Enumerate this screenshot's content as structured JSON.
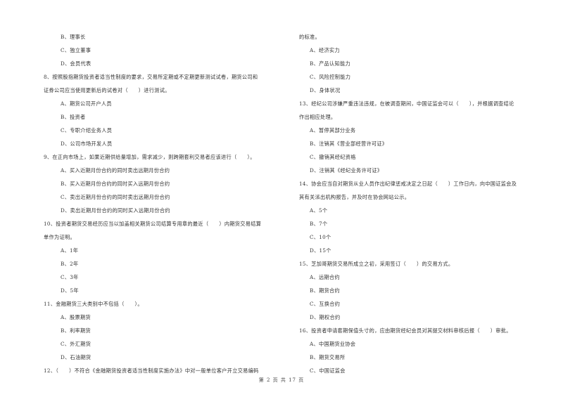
{
  "left_column": [
    {
      "type": "opt",
      "text": "B、理事长"
    },
    {
      "type": "opt",
      "text": "C、独立董事"
    },
    {
      "type": "opt",
      "text": "D、会员代表"
    },
    {
      "type": "q",
      "text": "8、按照股指期货投资者适当性制度的要求，交易所定期或不定期更新测试试卷，期货公司和"
    },
    {
      "type": "q",
      "text": "证券公司应当使用更新后的试卷对（　　）进行测试。"
    },
    {
      "type": "opt",
      "text": "A、期货公司开户人员"
    },
    {
      "type": "opt",
      "text": "B、投资者"
    },
    {
      "type": "opt",
      "text": "C、专职介绍业务人员"
    },
    {
      "type": "opt",
      "text": "D、公司市场开发人员"
    },
    {
      "type": "q",
      "text": "9、在正向市场上，如果近期供给量增加，需求减少，则跨期套利交易者应该进行（　　）。"
    },
    {
      "type": "opt",
      "text": "A、买入近期月份合约的同时卖出远期月份合约"
    },
    {
      "type": "opt",
      "text": "B、买入近期月份合约的同时买入远期月份合约"
    },
    {
      "type": "opt",
      "text": "C、卖出近期月份合约的同时卖出远期月份合约"
    },
    {
      "type": "opt",
      "text": "D、卖出近期月份合约的同时买入远期月份合约"
    },
    {
      "type": "q",
      "text": "10、投资者期货交易经历应当以加盖相关期货公司结算专用章的最近（　　）内期货交易结算"
    },
    {
      "type": "q",
      "text": "单作为证明。"
    },
    {
      "type": "opt",
      "text": "A、1年"
    },
    {
      "type": "opt",
      "text": "B、2年"
    },
    {
      "type": "opt",
      "text": "C、3年"
    },
    {
      "type": "opt",
      "text": "D、5年"
    },
    {
      "type": "q",
      "text": "11、金融期货三大类别中不包括（　　）。"
    },
    {
      "type": "opt",
      "text": "A、股票期货"
    },
    {
      "type": "opt",
      "text": "B、利率期货"
    },
    {
      "type": "opt",
      "text": "C、外汇期货"
    },
    {
      "type": "opt",
      "text": "D、石油期货"
    },
    {
      "type": "q",
      "text": "12、（　　）不符合《金融期货投资者适当性制度实施办法》中对一般单位客户开立交易编码"
    }
  ],
  "right_column": [
    {
      "type": "q",
      "text": "的标准。"
    },
    {
      "type": "opt",
      "text": "A、经济实力"
    },
    {
      "type": "opt",
      "text": "B、产品认知能力"
    },
    {
      "type": "opt",
      "text": "C、风险控制能力"
    },
    {
      "type": "opt",
      "text": "D、身体状况"
    },
    {
      "type": "q",
      "text": "13、经纪公司涉嫌严重违法违规，在被调查期间，中国证监会可以（　　），并根据调查结论"
    },
    {
      "type": "q",
      "text": "作出相应处理。"
    },
    {
      "type": "opt",
      "text": "A、暂停其部分业务"
    },
    {
      "type": "opt",
      "text": "B、注销其《营业部经营许可证》"
    },
    {
      "type": "opt",
      "text": "C、撤销其经纪资格"
    },
    {
      "type": "opt",
      "text": "D、注销其《经纪业务许可证》"
    },
    {
      "type": "q",
      "text": "14、协会应当自对期货从业人员作出纪律惩戒决定之日起（　　）工作日内，向中国证监会及"
    },
    {
      "type": "q",
      "text": "其有关派出机构报告，并及时在协会网站公示。"
    },
    {
      "type": "opt",
      "text": "A、5个"
    },
    {
      "type": "opt",
      "text": "B、7个"
    },
    {
      "type": "opt",
      "text": "C、10个"
    },
    {
      "type": "opt",
      "text": "D、15个"
    },
    {
      "type": "q",
      "text": "15、芝加哥期货交易所成立之初，采用签订（　　）的交易方式。"
    },
    {
      "type": "opt",
      "text": "A、远期合约"
    },
    {
      "type": "opt",
      "text": "B、期货合约"
    },
    {
      "type": "opt",
      "text": "C、互换合约"
    },
    {
      "type": "opt",
      "text": "D、期权合约"
    },
    {
      "type": "q",
      "text": "16、投资者申请套期保值头寸的，应由期货经纪会员对其提交材料审核后报（　　）审批。"
    },
    {
      "type": "opt",
      "text": "A、中国期货业协会"
    },
    {
      "type": "opt",
      "text": "B、期货交易所"
    },
    {
      "type": "opt",
      "text": "C、中国证监会"
    }
  ],
  "footer": {
    "page_label": "第 2 页 共 17 页"
  }
}
